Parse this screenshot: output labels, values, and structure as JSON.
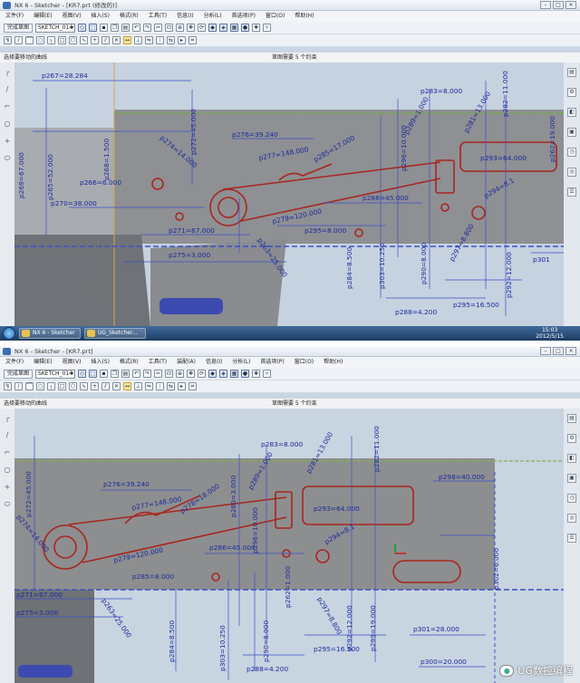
{
  "screenshot_top": {
    "window_title": "NX 6 - Sketcher - [KR7.prt (修改的)]",
    "menu": [
      "文件(F)",
      "编辑(E)",
      "视图(V)",
      "插入(S)",
      "格式(R)",
      "工具(T)",
      "信息(I)",
      "分析(L)",
      "首选项(P)",
      "窗口(O)",
      "帮助(H)"
    ],
    "finish_sketch_label": "完成草图",
    "sketch_name": "SKETCH_014",
    "status_prompt": "选择要移动的曲线",
    "status_constraints": "草图需要 5 个约束",
    "dimensions": {
      "p267": "p267=28.284",
      "p276": "p276=39.240",
      "p277": "p277=148.000",
      "p274": "p274=14.000",
      "p285": "p285=17.000",
      "p289": "p289=1.000",
      "p272": "p272=45.000",
      "p283": "p283=8.000",
      "p281": "p281=13.000",
      "p282": "p282=11.000",
      "p293": "p293=64.000",
      "p286": "p286=45.000",
      "p279": "p279=120.000",
      "p266": "p266=6.000",
      "p270": "p270=38.000",
      "p271": "p271=67.000",
      "p275": "p275=3.000",
      "p263": "p263=25.000",
      "p296": "p296=10.000",
      "p262": "p262=19.000",
      "p295": "p295=8.000",
      "p303": "p303=10.250",
      "p284": "p284=8.500",
      "p290": "p290=8.000",
      "p297": "p297=8.800",
      "p288": "p288=4.200",
      "p295b": "p295=16.500",
      "p292": "p292=12.000",
      "p294": "p294=8.1",
      "p301": "p301",
      "p265": "p265=52.000",
      "p269": "p269=67.000",
      "p268": "p268=1.500"
    },
    "taskbar": {
      "items": [
        "NX 6 - Sketcher",
        "UG_Sketcher..."
      ],
      "time": "15:03",
      "date": "2012/5/15"
    }
  },
  "screenshot_bottom": {
    "window_title": "NX 6 - Sketcher - [KR7.prt]",
    "menu": [
      "文件(F)",
      "编辑(E)",
      "视图(V)",
      "插入(S)",
      "格式(R)",
      "工具(T)",
      "装配(A)",
      "信息(I)",
      "分析(L)",
      "首选项(P)",
      "窗口(O)",
      "帮助(H)"
    ],
    "finish_sketch_label": "完成草图",
    "sketch_name": "SKETCH_014",
    "status_prompt": "选择要移动的曲线",
    "status_constraints": "草图需要 5 个约束",
    "dimensions": {
      "p272": "p272=45.000",
      "p276": "p276=39.240",
      "p277": "p277=148.000",
      "p278": "p278=18.000",
      "p283": "p283=8.000",
      "p289": "p289=1.000",
      "p281": "p281=13.000",
      "p282": "p282=11.000",
      "p298": "p298=40.000",
      "p293": "p293=64.000",
      "p280": "p280=3.000",
      "p274": "p274=14.000",
      "p279": "p279=120.000",
      "p286": "p286=45.000",
      "p285": "p285=8.000",
      "p271": "p271=67.000",
      "p275": "p275=3.000",
      "p263": "p263=25.000",
      "p284": "p284=8.500",
      "p303": "p303=10.250",
      "p290": "p290=8.000",
      "p297": "p297=8.800",
      "p292": "p292=12.000",
      "p299": "p299=19.000",
      "p302": "p302=6.000",
      "p301": "p301=28.000",
      "p300": "p300=20.000",
      "p288": "p288=4.200",
      "p295": "p295=16.500",
      "p294": "p294=8.1",
      "p262": "p262=1.000",
      "p296": "p296=10.000"
    },
    "watermark": "UG数控编程"
  },
  "colors": {
    "dimension": "#1c2a9e",
    "sketch_curve": "#a8261e",
    "construction": "#4d6bd6",
    "part_gray": "#8d8e90",
    "background": "#c9d6e3"
  }
}
